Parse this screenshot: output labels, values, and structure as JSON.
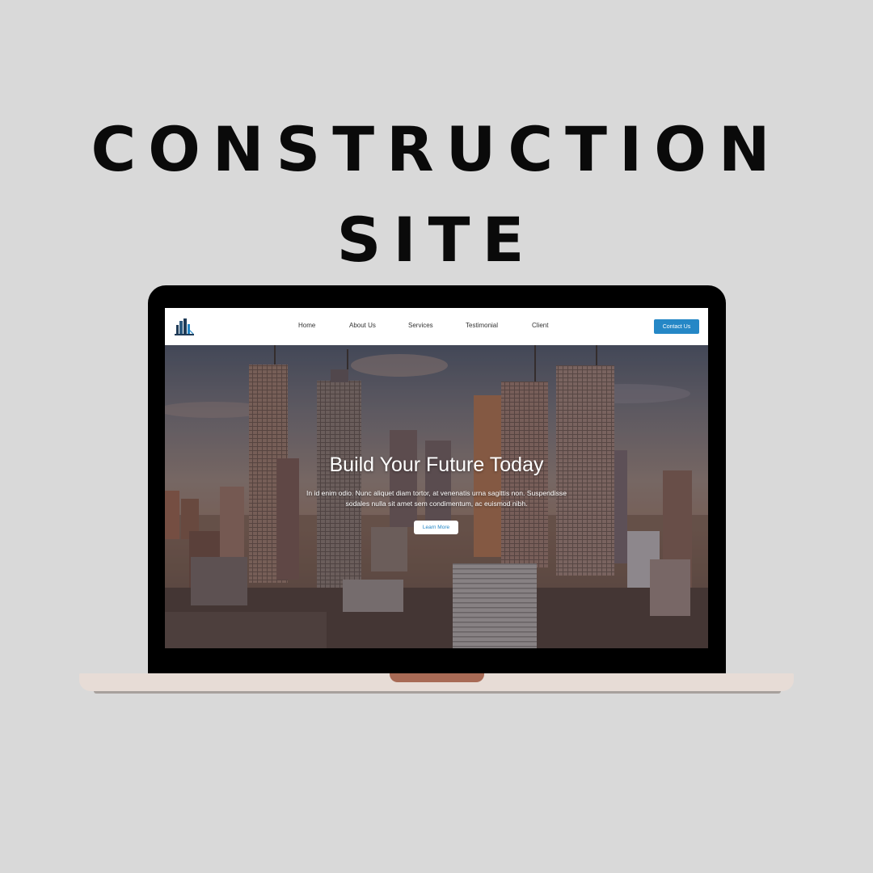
{
  "graphic": {
    "title_line1": "CONSTRUCTION",
    "title_line2": "SITE"
  },
  "site": {
    "nav": {
      "items": [
        "Home",
        "About Us",
        "Services",
        "Testimonial",
        "Client"
      ],
      "contact_label": "Contact Us"
    },
    "hero": {
      "title": "Build Your Future Today",
      "text_line1": "In id enim odio. Nunc aliquet diam tortor, at venenatis urna sagittis non. Suspendisse",
      "text_line2": "sodales nulla sit amet sem condimentum, ac euismod nibh.",
      "button_label": "Learn More"
    }
  },
  "colors": {
    "background": "#d9d9d9",
    "accent": "#2587c6",
    "laptop_base": "#e7dcd6",
    "laptop_notch": "#a86a55"
  },
  "icons": {
    "logo": "building-logo-icon"
  }
}
